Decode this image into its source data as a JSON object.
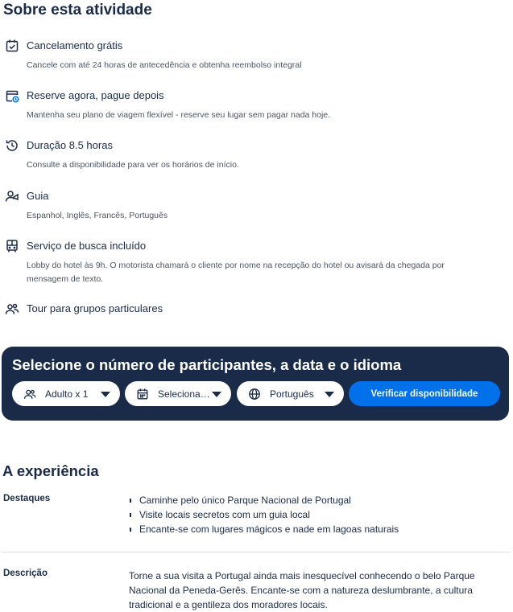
{
  "about": {
    "title": "Sobre esta atividade",
    "features": [
      {
        "icon": "calendar-check-icon",
        "title": "Cancelamento grátis",
        "desc": "Cancele com até 24 horas de antecedência e obtenha reembolso integral"
      },
      {
        "icon": "calendar-clock-icon",
        "title": "Reserve agora, pague depois",
        "desc": "Mantenha seu plano de viagem flexível - reserve seu lugar sem pagar nada hoje."
      },
      {
        "icon": "clock-history-icon",
        "title": "Duração 8.5 horas",
        "desc": "Consulte a disponibilidade para ver os horários de início."
      },
      {
        "icon": "guide-person-icon",
        "title": "Guia",
        "desc": "Espanhol, Inglês, Francês, Português"
      },
      {
        "icon": "bus-icon",
        "title": "Serviço de busca incluído",
        "desc": "Lobby do hotel às 9h. O motorista chamará o cliente por nome na recepção do hotel ou avisará da chegada por mensagem de texto."
      },
      {
        "icon": "group-icon",
        "title": "Tour para grupos particulares",
        "desc": ""
      }
    ]
  },
  "booking": {
    "title": "Selecione o número de participantes, a data e o idioma",
    "participants": "Adulto x 1",
    "date": "Seleciona…",
    "language": "Português",
    "cta": "Verificar disponibilidade"
  },
  "experience": {
    "title": "A experiência",
    "highlights_label": "Destaques",
    "highlights": [
      "Caminhe pelo único Parque Nacional de Portugal",
      "Visite locais secretos com um guia local",
      "Encante-se com lugares mágicos e nade em lagoas naturais"
    ],
    "description_label": "Descrição",
    "description": "Torne a sua visita a Portugal ainda mais inesquecível conhecendo o belo Parque Nacional da Peneda-Gerês. Encante-se com a natureza deslumbrante, a cultura tradicional e a gentileza dos moradores locais."
  },
  "colors": {
    "navy": "#1a2b49",
    "accent": "#0071eb",
    "muted": "#4b5563"
  }
}
